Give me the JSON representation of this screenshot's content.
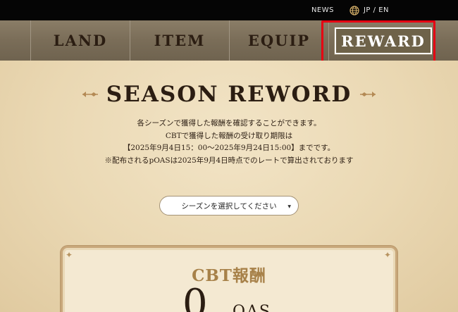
{
  "topbar": {
    "news": "NEWS",
    "lang": "JP / EN",
    "globe_icon": "globe-icon"
  },
  "nav": {
    "items": [
      {
        "label": "LAND"
      },
      {
        "label": "ITEM"
      },
      {
        "label": "EQUIP"
      },
      {
        "label": "REWARD",
        "active": true
      }
    ],
    "highlight_color": "#e60012"
  },
  "page": {
    "title": "SEASON REWORD",
    "desc_lines": [
      "各シーズンで獲得した報酬を確認することができます。",
      "CBTで獲得した報酬の受け取り期限は",
      "【2025年9月4日15：00～2025年9月24日15:00】までです。",
      "※配布されるpOASは2025年9月4日時点でのレートで算出されております"
    ]
  },
  "season_select": {
    "label": "シーズンを選択してください"
  },
  "reward_card": {
    "title": "CBT報酬",
    "value": "0",
    "unit": "OAS"
  },
  "colors": {
    "topbar": "#050505",
    "nav": "#7a6d58",
    "parchment": "#ecdcba",
    "text": "#2b1d12",
    "card_title": "#a78149"
  }
}
